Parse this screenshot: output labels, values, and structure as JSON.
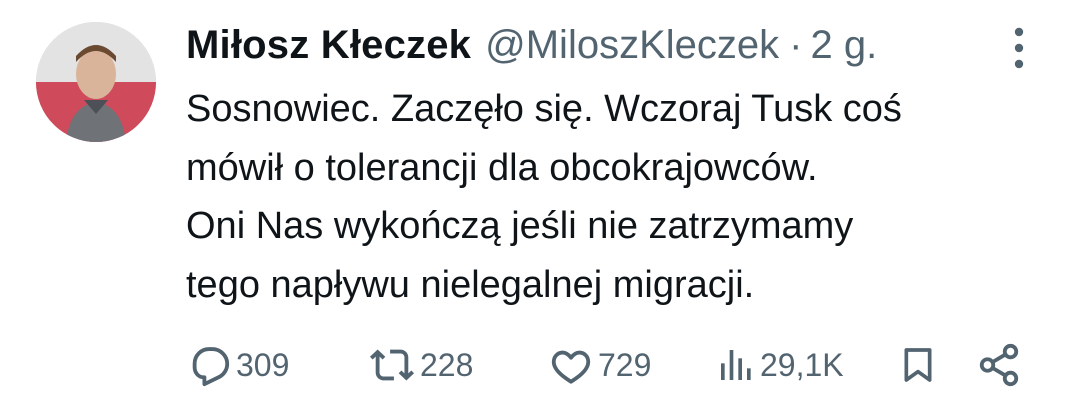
{
  "tweet": {
    "author_name": "Miłosz Kłeczek",
    "handle": "@MiloszKleczek",
    "separator": "·",
    "time": "2 g.",
    "lines": [
      "Sosnowiec. Zaczęło się. Wczoraj Tusk coś",
      "mówił o tolerancji dla obcokrajowców.",
      "Oni Nas wykończą jeśli nie zatrzymamy",
      "tego napływu nielegalnej migracji."
    ]
  },
  "actions": {
    "replies": "309",
    "retweets": "228",
    "likes": "729",
    "views": "29,1K"
  },
  "icons": [
    "avatar",
    "more-icon",
    "reply-icon",
    "retweet-icon",
    "like-icon",
    "views-icon",
    "bookmark-icon",
    "share-icon"
  ],
  "colors": {
    "text": "#0f1419",
    "secondary": "#536471",
    "background": "#ffffff"
  }
}
